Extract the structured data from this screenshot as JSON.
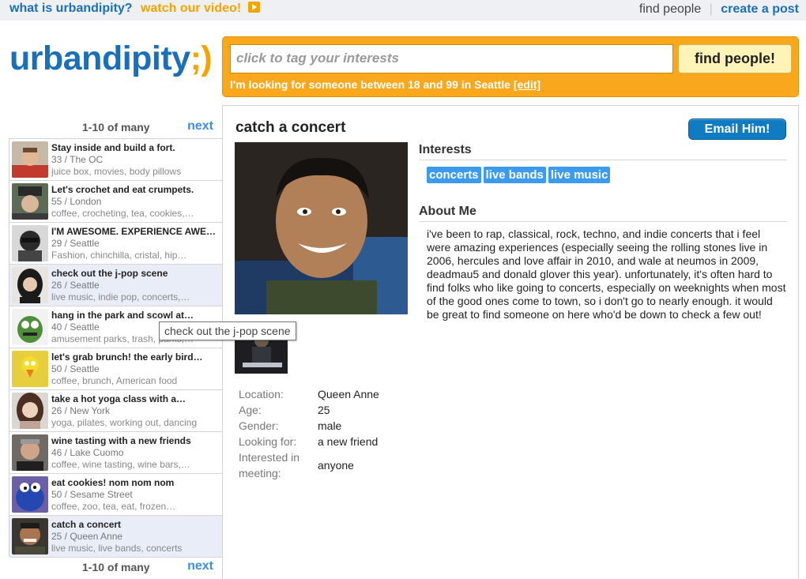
{
  "topbar": {
    "what_label": "what is urbandipity?",
    "watch_label": "watch our video!",
    "find_people": "find people",
    "create_post": "create a post"
  },
  "logo": {
    "text": "urbandipity",
    "smile": ";)"
  },
  "search": {
    "placeholder": "click to tag your interests",
    "button": "find people!",
    "looking_text": "I'm looking for someone between 18 and 99 in Seattle",
    "edit": "[edit]"
  },
  "pager": {
    "count": "1-10 of many",
    "next": "next"
  },
  "list": [
    {
      "title": "Stay inside and build a fort.",
      "meta": "33 / The OC",
      "tags": "juice box, movies, body pillows"
    },
    {
      "title": "Let's crochet and eat crumpets.",
      "meta": "55 / London",
      "tags": "coffee, crocheting, tea, cookies,…"
    },
    {
      "title": "I'M AWESOME. EXPERIENCE AWESOME",
      "meta": "29 / Seattle",
      "tags": "Fashion, chinchilla, cristal, hip…"
    },
    {
      "title": "check out the j-pop scene",
      "meta": "26 / Seattle",
      "tags": "live music, indie pop, concerts,…"
    },
    {
      "title": "hang in the park and scowl at…",
      "meta": "40 / Seattle",
      "tags": "amusement parks, trash, parks,…"
    },
    {
      "title": "let's grab brunch! the early bird…",
      "meta": "50 / Seattle",
      "tags": "coffee, brunch, American food"
    },
    {
      "title": "take a hot yoga class with a…",
      "meta": "26 / New York",
      "tags": "yoga, pilates, working out, dancing"
    },
    {
      "title": "wine tasting with a new friends",
      "meta": "46 / Lake Cuomo",
      "tags": "coffee, wine tasting, wine bars,…"
    },
    {
      "title": "eat cookies! nom nom nom",
      "meta": "50 / Sesame Street",
      "tags": "coffee, zoo, tea, eat, frozen…"
    },
    {
      "title": "catch a concert",
      "meta": "25 / Queen Anne",
      "tags": "live music, live bands, concerts"
    }
  ],
  "tooltip": "check out the j-pop scene",
  "profile": {
    "title": "catch a concert",
    "email_button": "Email Him!",
    "interests_heading": "Interests",
    "tags": [
      "concerts",
      "live bands",
      "live music"
    ],
    "about_heading": "About Me",
    "about_text": "i've been to rap, classical, rock, techno, and indie concerts that i feel were amazing experiences (especially seeing the rolling stones live in 2006, hercules and love affair in 2010, and wale at neumos in 2009, deadmau5 and donald glover this year). unfortunately, it's often hard to find folks who like going to concerts, especially on weeknights when most of the good ones come to town, so i don't go to nearly enough. it would be great to find someone on here who'd be down to check a few out!",
    "details": {
      "location_label": "Location:",
      "location": "Queen Anne",
      "age_label": "Age:",
      "age": "25",
      "gender_label": "Gender:",
      "gender": "male",
      "looking_label": "Looking for:",
      "looking": "a new friend",
      "meeting_label_1": "Interested in",
      "meeting_label_2": "meeting:",
      "meeting": "anyone"
    }
  }
}
